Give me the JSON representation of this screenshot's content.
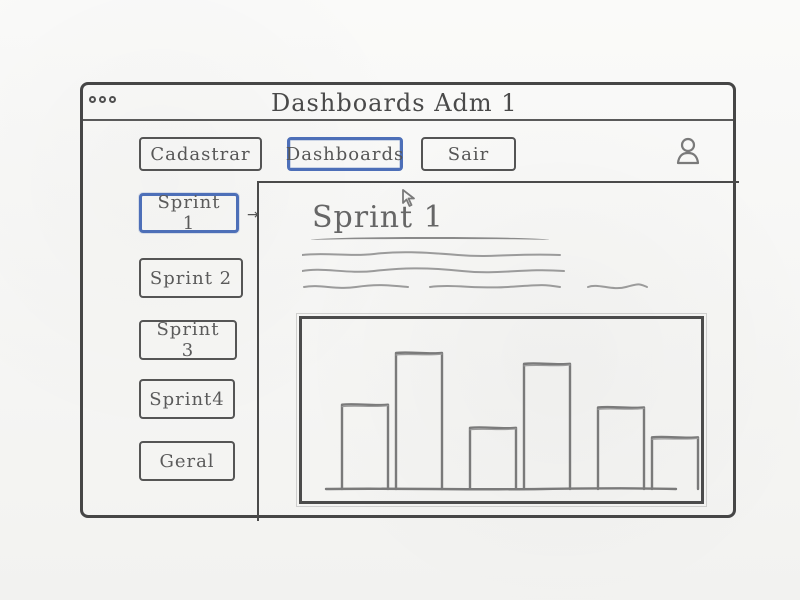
{
  "window": {
    "title": "Dashboards  Adm 1",
    "controls": [
      "circle-icon",
      "circle-icon",
      "circle-icon"
    ]
  },
  "topnav": {
    "items": [
      {
        "label": "Cadastrar",
        "active": false
      },
      {
        "label": "Dashboards",
        "active": true
      },
      {
        "label": "Sair",
        "active": false
      }
    ],
    "user_icon": "user-icon"
  },
  "sidebar": {
    "items": [
      {
        "label": "Sprint 1",
        "active": true
      },
      {
        "label": "Sprint 2",
        "active": false
      },
      {
        "label": "Sprint 3",
        "active": false
      },
      {
        "label": "Sprint4",
        "active": false
      },
      {
        "label": "Geral",
        "active": false
      }
    ]
  },
  "content": {
    "title": "Sprint 1",
    "cursor_icon": "cursor-icon"
  },
  "chart_data": {
    "type": "bar",
    "groups": 3,
    "series": [
      {
        "values": [
          62,
          45,
          60
        ]
      },
      {
        "values": [
          100,
          92,
          38
        ]
      }
    ]
  },
  "colors": {
    "accent": "#4d6fb8",
    "ink": "#464646",
    "paper": "#f7f7f5"
  }
}
